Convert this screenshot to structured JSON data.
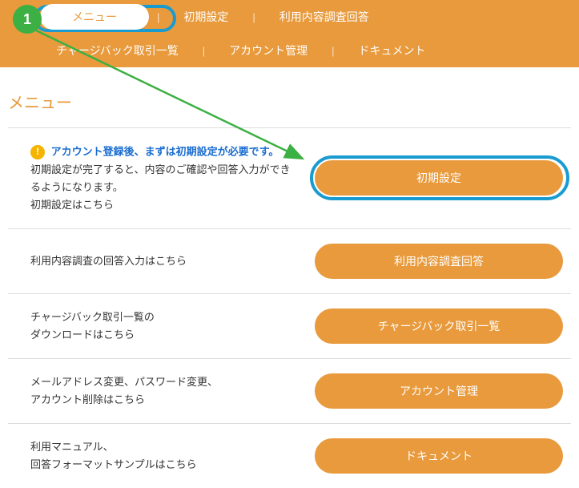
{
  "badge": {
    "number": "1"
  },
  "header": {
    "row1": [
      {
        "label": "メニュー",
        "active": true
      },
      {
        "label": "初期設定"
      },
      {
        "label": "利用内容調査回答"
      }
    ],
    "row2": [
      {
        "label": "チャージバック取引一覧"
      },
      {
        "label": "アカウント管理"
      },
      {
        "label": "ドキュメント"
      }
    ]
  },
  "page_title": "メニュー",
  "sections": [
    {
      "info_title": "アカウント登録後、まずは初期設定が必要です。",
      "desc_line1": "初期設定が完了すると、内容のご確認や回答入力ができるようになります。",
      "desc_line2": "初期設定はこちら",
      "button": "初期設定",
      "highlighted": true
    },
    {
      "desc_line1": "利用内容調査の回答入力はこちら",
      "button": "利用内容調査回答"
    },
    {
      "desc_line1": "チャージバック取引一覧の",
      "desc_line2": "ダウンロードはこちら",
      "button": "チャージバック取引一覧"
    },
    {
      "desc_line1": "メールアドレス変更、パスワード変更、",
      "desc_line2": "アカウント削除はこちら",
      "button": "アカウント管理"
    },
    {
      "desc_line1": "利用マニュアル、",
      "desc_line2": "回答フォーマットサンプルはこちら",
      "button": "ドキュメント"
    }
  ]
}
